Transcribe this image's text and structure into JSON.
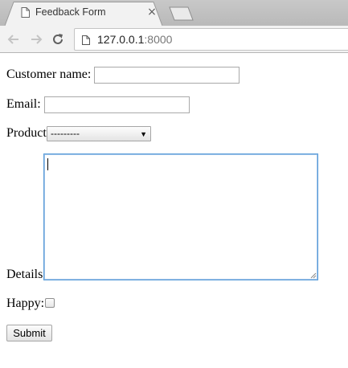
{
  "browser": {
    "tab_title": "Feedback Form",
    "tab_close_glyph": "×",
    "url_host": "127.0.0.1",
    "url_port": ":8000",
    "icons": {
      "tab": "page-icon",
      "close": "close-icon",
      "new_tab": "new-tab-icon",
      "back": "back-arrow-icon",
      "forward": "forward-arrow-icon",
      "reload": "reload-icon",
      "site_info": "page-info-icon"
    },
    "colors": {
      "tabstrip": "#bebebe",
      "toolbar": "#f2f2f2",
      "disabled_nav": "#c4c4c4"
    }
  },
  "form": {
    "customer_name": {
      "label": "Customer name:",
      "value": ""
    },
    "email": {
      "label": "Email:",
      "value": ""
    },
    "product": {
      "label": "Product:",
      "selected": "---------"
    },
    "details": {
      "label": "Details:",
      "value": "",
      "focused": true,
      "focus_color": "#5b9dd9"
    },
    "happy": {
      "label": "Happy:",
      "checked": false
    },
    "submit_label": "Submit"
  }
}
